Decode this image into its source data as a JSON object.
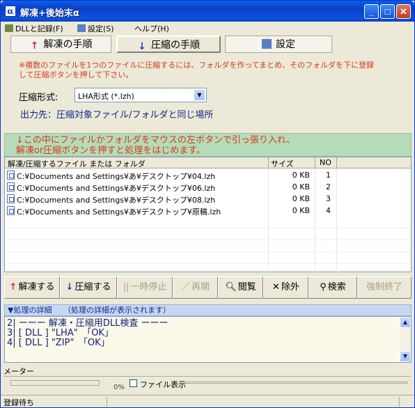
{
  "window": {
    "title": "解凍+後始末α",
    "app_icon": "α"
  },
  "menu": [
    {
      "label": "DLLと記録(F)"
    },
    {
      "label": "設定(S)"
    },
    {
      "label": "ヘルプ(H)"
    }
  ],
  "tabs": [
    {
      "label": "解凍の手順"
    },
    {
      "label": "圧縮の手順"
    },
    {
      "label": "設定"
    }
  ],
  "note": "※複数のファイルを1つのファイルに圧縮するには、フォルダを作ってまとめ、そのフォルダを下に登録して圧縮ボタンを押して下さい。",
  "format": {
    "label": "圧縮形式:",
    "value": "LHA形式 (*.lzh)"
  },
  "dest": {
    "label": "出力先：",
    "value": "圧縮対象ファイル/フォルダと同じ場所"
  },
  "drop_hint": "↓この中にファイルかフォルダをマウスの左ボタンで引っ張り入れ、\n解凍or圧縮ボタンを押すと処理をはじめます。",
  "list": {
    "headers": {
      "name": "解凍/圧縮するファイル または フォルダ",
      "size": "サイズ",
      "no": "NO"
    },
    "rows": [
      {
        "name": "C:¥Documents and Settings¥あ¥デスクトップ¥04.lzh",
        "size": "0 KB",
        "no": "1"
      },
      {
        "name": "C:¥Documents and Settings¥あ¥デスクトップ¥06.lzh",
        "size": "0 KB",
        "no": "2"
      },
      {
        "name": "C:¥Documents and Settings¥あ¥デスクトップ¥08.lzh",
        "size": "0 KB",
        "no": "3"
      },
      {
        "name": "C:¥Documents and Settings¥あ¥デスクトップ¥原稿.lzh",
        "size": "0 KB",
        "no": "4"
      }
    ]
  },
  "toolbar": {
    "extract": "解凍する",
    "compress": "圧縮する",
    "pause": "一時停止",
    "resume": "再開",
    "view": "閲覧",
    "exclude": "除外",
    "search": "検索",
    "force_stop": "強制終了"
  },
  "detail": {
    "header": "▼処理の詳細　　（処理の詳細が表示されます）",
    "lines": [
      "2| ーーー 解凍・圧縮用DLL検査 ーーー",
      "3| [ DLL ] \"LHA\"　「OK」",
      "4| [ DLL ] \"ZIP\"　「OK」"
    ]
  },
  "meter": {
    "label": "メーター",
    "percent_text": "0%",
    "progress": 0,
    "file_display": "ファイル表示"
  },
  "status": "登録待ち"
}
